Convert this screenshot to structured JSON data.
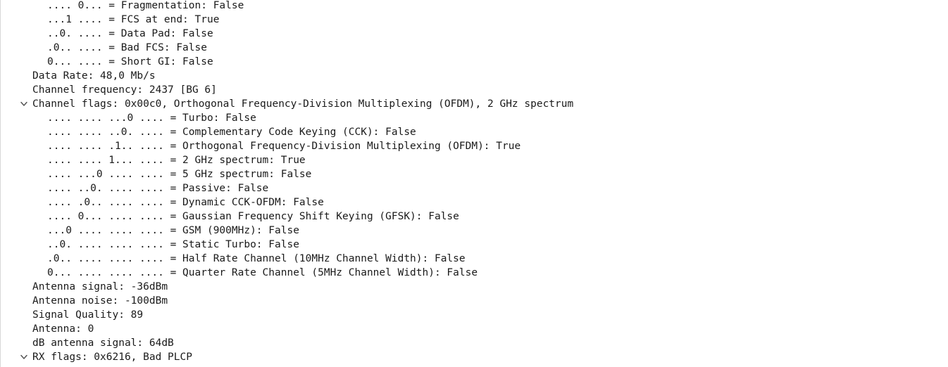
{
  "tree": {
    "rows": [
      {
        "level": 2,
        "text": ".... 0... = Fragmentation: False"
      },
      {
        "level": 2,
        "text": "...1 .... = FCS at end: True"
      },
      {
        "level": 2,
        "text": "..0. .... = Data Pad: False"
      },
      {
        "level": 2,
        "text": ".0.. .... = Bad FCS: False"
      },
      {
        "level": 2,
        "text": "0... .... = Short GI: False"
      },
      {
        "level": 1,
        "text": "Data Rate: 48,0 Mb/s"
      },
      {
        "level": 1,
        "text": "Channel frequency: 2437 [BG 6]"
      },
      {
        "level": 1,
        "expanded": true,
        "icon": "chevron-down-icon",
        "text": "Channel flags: 0x00c0, Orthogonal Frequency-Division Multiplexing (OFDM), 2 GHz spectrum"
      },
      {
        "level": 2,
        "text": ".... .... ...0 .... = Turbo: False"
      },
      {
        "level": 2,
        "text": ".... .... ..0. .... = Complementary Code Keying (CCK): False"
      },
      {
        "level": 2,
        "text": ".... .... .1.. .... = Orthogonal Frequency-Division Multiplexing (OFDM): True"
      },
      {
        "level": 2,
        "text": ".... .... 1... .... = 2 GHz spectrum: True"
      },
      {
        "level": 2,
        "text": ".... ...0 .... .... = 5 GHz spectrum: False"
      },
      {
        "level": 2,
        "text": ".... ..0. .... .... = Passive: False"
      },
      {
        "level": 2,
        "text": ".... .0.. .... .... = Dynamic CCK-OFDM: False"
      },
      {
        "level": 2,
        "text": ".... 0... .... .... = Gaussian Frequency Shift Keying (GFSK): False"
      },
      {
        "level": 2,
        "text": "...0 .... .... .... = GSM (900MHz): False"
      },
      {
        "level": 2,
        "text": "..0. .... .... .... = Static Turbo: False"
      },
      {
        "level": 2,
        "text": ".0.. .... .... .... = Half Rate Channel (10MHz Channel Width): False"
      },
      {
        "level": 2,
        "text": "0... .... .... .... = Quarter Rate Channel (5MHz Channel Width): False"
      },
      {
        "level": 1,
        "text": "Antenna signal: -36dBm"
      },
      {
        "level": 1,
        "text": "Antenna noise: -100dBm"
      },
      {
        "level": 1,
        "text": "Signal Quality: 89"
      },
      {
        "level": 1,
        "text": "Antenna: 0"
      },
      {
        "level": 1,
        "text": "dB antenna signal: 64dB"
      },
      {
        "level": 1,
        "expanded": true,
        "icon": "chevron-down-icon",
        "text": "RX flags: 0x6216, Bad PLCP"
      }
    ]
  },
  "colors": {
    "text": "#1a1a1a",
    "toggle": "#505050",
    "background": "#ffffff"
  }
}
